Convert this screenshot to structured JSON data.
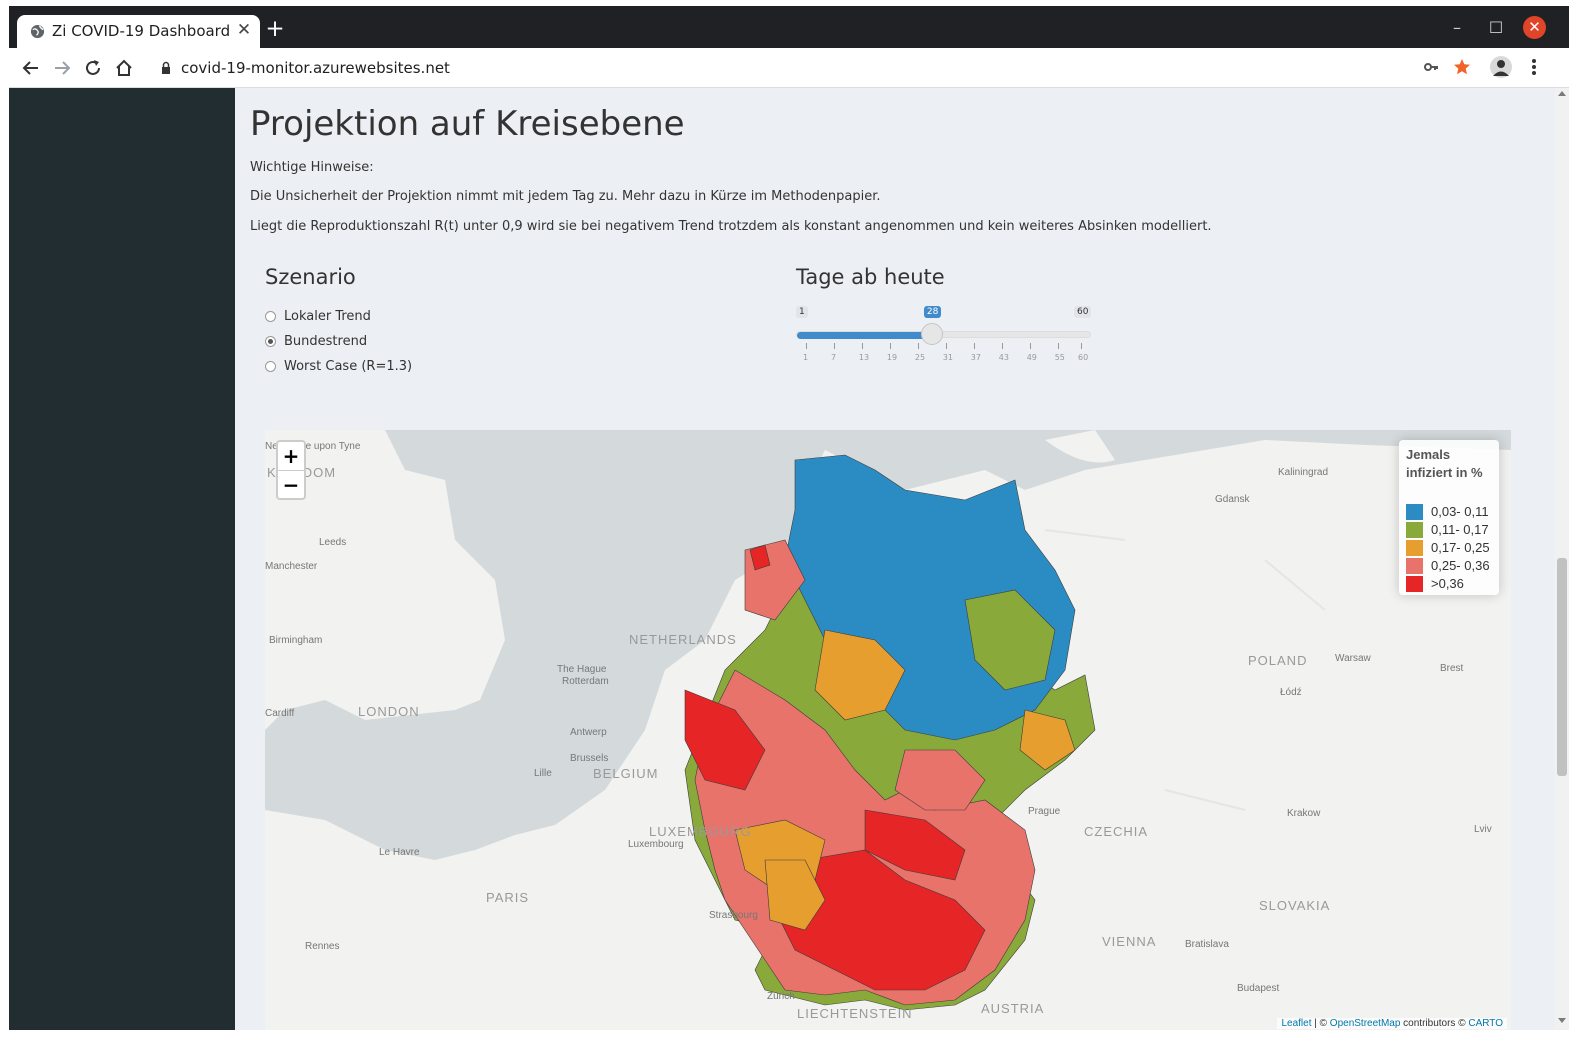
{
  "browser": {
    "tab_title": "Zi COVID-19 Dashboard",
    "tab_close": "✕",
    "new_tab": "+",
    "url": "covid-19-monitor.azurewebsites.net",
    "window_controls": {
      "minimize": "–",
      "maximize": "☐",
      "close": "✕"
    }
  },
  "page": {
    "title": "Projektion auf Kreisebene",
    "notes": [
      "Wichtige Hinweise:",
      "Die Unsicherheit der Projektion nimmt mit jedem Tag zu. Mehr dazu in Kürze im Methodenpapier.",
      "Liegt die Reproduktionszahl R(t) unter 0,9 wird sie bei negativem Trend trotzdem als konstant angenommen und kein weiteres Absinken modelliert."
    ]
  },
  "scenario": {
    "heading": "Szenario",
    "options": [
      {
        "label": "Lokaler Trend",
        "selected": false
      },
      {
        "label": "Bundestrend",
        "selected": true
      },
      {
        "label": "Worst Case (R=1.3)",
        "selected": false
      }
    ]
  },
  "slider": {
    "heading": "Tage ab heute",
    "min": 1,
    "max": 60,
    "value": 28,
    "min_label": "1",
    "max_label": "60",
    "value_label": "28",
    "ticks": [
      1,
      7,
      13,
      19,
      25,
      31,
      37,
      43,
      49,
      55,
      60
    ]
  },
  "map": {
    "zoom_in": "+",
    "zoom_out": "−",
    "legend": {
      "title": "Jemals infiziert in %",
      "items": [
        {
          "label": "0,03- 0,11",
          "color": "#2b8cc4"
        },
        {
          "label": "0,11- 0,17",
          "color": "#8aa93b"
        },
        {
          "label": "0,17- 0,25",
          "color": "#e69f2f"
        },
        {
          "label": "0,25- 0,36",
          "color": "#e8736a"
        },
        {
          "label": ">0,36",
          "color": "#e62526"
        }
      ]
    },
    "attribution": {
      "leaflet": "Leaflet",
      "sep1": " | © ",
      "osm": "OpenStreetMap",
      "sep2": " contributors © ",
      "carto": "CARTO"
    },
    "cities": [
      {
        "name": "Newcastle upon Tyne"
      },
      {
        "name": "KINGDOM"
      },
      {
        "name": "Leeds"
      },
      {
        "name": "Manchester"
      },
      {
        "name": "Birmingham"
      },
      {
        "name": "LONDON"
      },
      {
        "name": "Cardiff"
      },
      {
        "name": "NETHERLANDS"
      },
      {
        "name": "The Hague"
      },
      {
        "name": "Rotterdam"
      },
      {
        "name": "Antwerp"
      },
      {
        "name": "Brussels"
      },
      {
        "name": "Lille"
      },
      {
        "name": "BELGIUM"
      },
      {
        "name": "LUXEMBOURG"
      },
      {
        "name": "Luxembourg"
      },
      {
        "name": "Le Havre"
      },
      {
        "name": "PARIS"
      },
      {
        "name": "Rennes"
      },
      {
        "name": "Strasbourg"
      },
      {
        "name": "Zurich"
      },
      {
        "name": "LIECHTENSTEIN"
      },
      {
        "name": "AUSTRIA"
      },
      {
        "name": "VIENNA"
      },
      {
        "name": "Bratislava"
      },
      {
        "name": "Budapest"
      },
      {
        "name": "SLOVAKIA"
      },
      {
        "name": "CZECHIA"
      },
      {
        "name": "Prague"
      },
      {
        "name": "Krakow"
      },
      {
        "name": "Lviv"
      },
      {
        "name": "POLAND"
      },
      {
        "name": "Warsaw"
      },
      {
        "name": "Łódź"
      },
      {
        "name": "Brest"
      },
      {
        "name": "Gdansk"
      },
      {
        "name": "Kaliningrad"
      }
    ]
  }
}
